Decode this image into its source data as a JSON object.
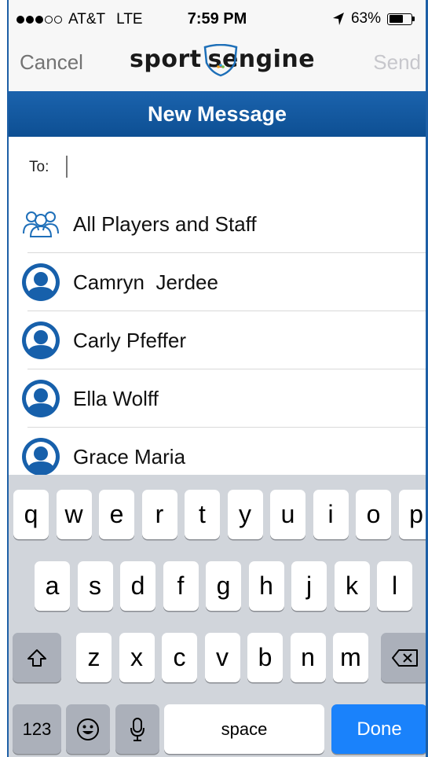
{
  "status_bar": {
    "carrier": "AT&T",
    "network": "LTE",
    "time": "7:59 PM",
    "battery": "63%",
    "battery_level": 0.63,
    "signal_bars_filled": 3,
    "signal_bars_total": 5
  },
  "nav": {
    "cancel_label": "Cancel",
    "send_label": "Send",
    "logo_left": "sport",
    "logo_right": "engine",
    "logo_mid": "s"
  },
  "title": "New Message",
  "to_field": {
    "label": "To:",
    "value": "",
    "placeholder": ""
  },
  "recipients": [
    {
      "label": "All Players and Staff",
      "icon": "group-icon"
    },
    {
      "label": "Camryn  Jerdee",
      "icon": "person-icon"
    },
    {
      "label": "Carly Pfeffer",
      "icon": "person-icon"
    },
    {
      "label": "Ella Wolff",
      "icon": "person-icon"
    },
    {
      "label": "Grace Maria",
      "icon": "person-icon"
    }
  ],
  "keyboard": {
    "row1": [
      "q",
      "w",
      "e",
      "r",
      "t",
      "y",
      "u",
      "i",
      "o",
      "p"
    ],
    "row2": [
      "a",
      "s",
      "d",
      "f",
      "g",
      "h",
      "j",
      "k",
      "l"
    ],
    "row3": [
      "z",
      "x",
      "c",
      "v",
      "b",
      "n",
      "m"
    ],
    "numbers_label": "123",
    "space_label": "space",
    "done_label": "Done"
  },
  "colors": {
    "brand_blue": "#0d4f93",
    "done_blue": "#1a82fb",
    "keyboard_bg": "#d1d5db"
  }
}
